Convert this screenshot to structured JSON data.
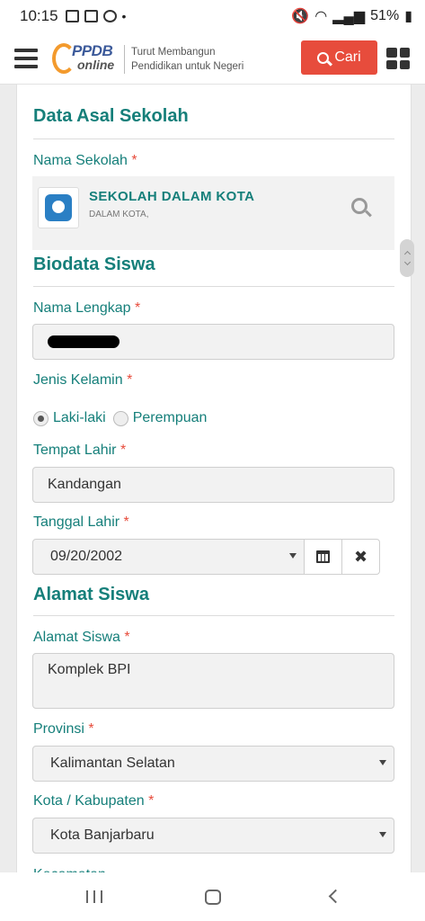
{
  "status_bar": {
    "time": "10:15",
    "dot": "•",
    "battery": "51%"
  },
  "header": {
    "logo_top": "PPDB",
    "logo_bottom": "online",
    "tagline_line1": "Turut Membangun",
    "tagline_line2": "Pendidikan untuk Negeri",
    "search_button": "Cari"
  },
  "sections": {
    "data_asal_sekolah": "Data Asal Sekolah",
    "biodata_siswa": "Biodata Siswa",
    "alamat_siswa": "Alamat Siswa"
  },
  "required_mark": "*",
  "school": {
    "label": "Nama Sekolah",
    "name": "SEKOLAH DALAM KOTA",
    "subtitle": "DALAM KOTA,"
  },
  "form": {
    "nama_lengkap": {
      "label": "Nama Lengkap"
    },
    "jenis_kelamin": {
      "label": "Jenis Kelamin",
      "option_male": "Laki-laki",
      "option_female": "Perempuan",
      "selected": "Laki-laki"
    },
    "tempat_lahir": {
      "label": "Tempat Lahir",
      "value": "Kandangan"
    },
    "tanggal_lahir": {
      "label": "Tanggal Lahir",
      "value": "09/20/2002",
      "clear": "✖"
    },
    "alamat_siswa": {
      "label": "Alamat Siswa",
      "value": "Komplek BPI"
    },
    "provinsi": {
      "label": "Provinsi",
      "value": "Kalimantan Selatan"
    },
    "kota_kabupaten": {
      "label": "Kota / Kabupaten",
      "value": "Kota Banjarbaru"
    },
    "next_label_partial": "Kecamatan"
  },
  "colors": {
    "accent": "#157f7a",
    "button": "#e74c3c",
    "required": "#e74c3c"
  },
  "icons": [
    "hamburger-icon",
    "grid-menu-icon",
    "search-icon",
    "calendar-icon",
    "close-icon"
  ]
}
